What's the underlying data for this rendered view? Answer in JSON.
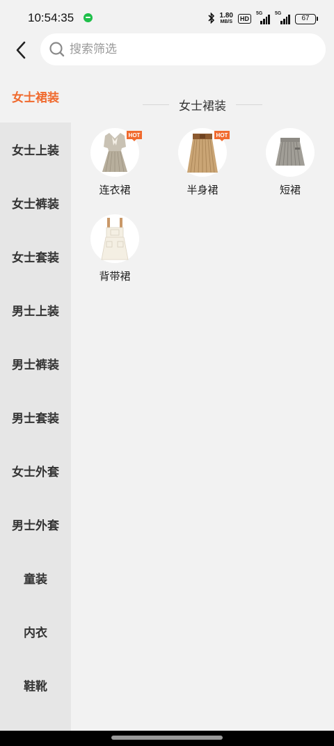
{
  "status_bar": {
    "time": "10:54:35",
    "net_speed_value": "1.80",
    "net_speed_unit": "MB/S",
    "hd_label": "HD",
    "signal1_label": "5G",
    "signal2_label": "5G",
    "battery": "67"
  },
  "search": {
    "placeholder": "搜索筛选"
  },
  "sidebar": {
    "items": [
      {
        "label": "女士裙装"
      },
      {
        "label": "女士上装"
      },
      {
        "label": "女士裤装"
      },
      {
        "label": "女士套装"
      },
      {
        "label": "男士上装"
      },
      {
        "label": "男士裤装"
      },
      {
        "label": "男士套装"
      },
      {
        "label": "女士外套"
      },
      {
        "label": "男士外套"
      },
      {
        "label": "童装"
      },
      {
        "label": "内衣"
      },
      {
        "label": "鞋靴"
      }
    ],
    "active_index": 0
  },
  "main": {
    "section_title": "女士裙装",
    "categories": [
      {
        "label": "连衣裙",
        "hot": true,
        "icon": "dress-icon"
      },
      {
        "label": "半身裙",
        "hot": true,
        "icon": "pleated-skirt-icon"
      },
      {
        "label": "短裙",
        "hot": false,
        "icon": "short-skirt-icon"
      },
      {
        "label": "背带裙",
        "hot": false,
        "icon": "overall-skirt-icon"
      }
    ],
    "hot_badge_text": "HOT"
  },
  "colors": {
    "accent": "#f06a2e",
    "sidebar_bg": "#e6e6e6",
    "page_bg": "#f2f2f2"
  }
}
